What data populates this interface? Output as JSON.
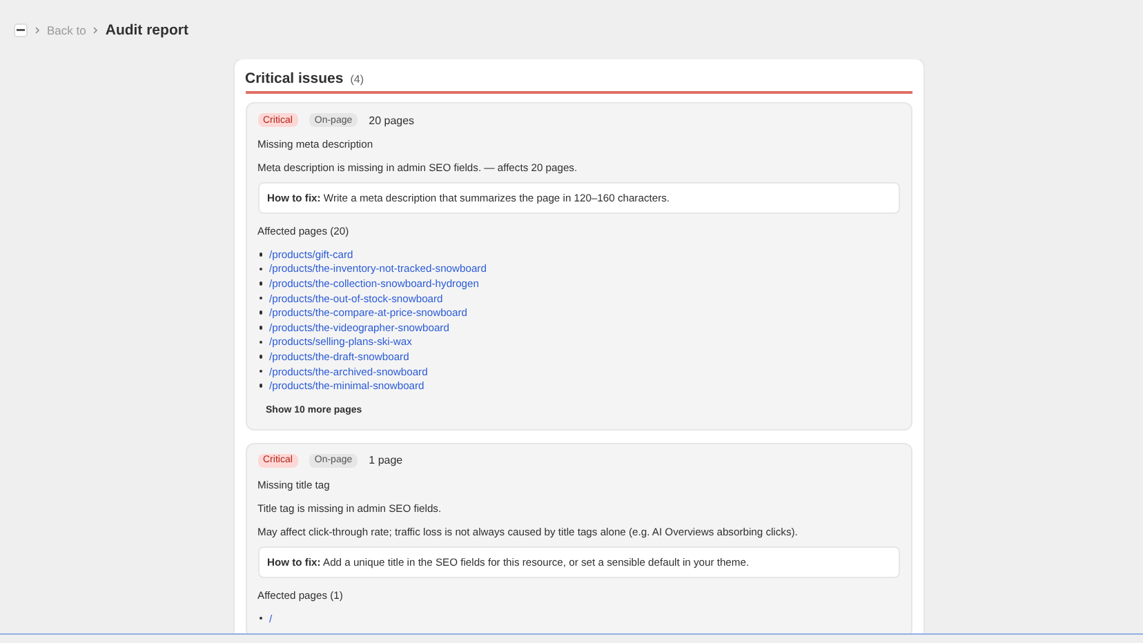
{
  "breadcrumb": {
    "back": "Back to",
    "current": "Audit report"
  },
  "section": {
    "title": "Critical issues",
    "count": "(4)"
  },
  "issues": [
    {
      "severity": "Critical",
      "category": "On-page",
      "page_count": "20 pages",
      "title": "Missing meta description",
      "description": "Meta description is missing in admin SEO fields. — affects 20 pages.",
      "fix": "**How to fix:** Write a meta description that summarizes the page in 120–160 characters.",
      "affected_label": "Affected pages (20)",
      "pages": [
        "/products/gift-card",
        "/products/the-inventory-not-tracked-snowboard",
        "/products/the-collection-snowboard-hydrogen",
        "/products/the-out-of-stock-snowboard",
        "/products/the-compare-at-price-snowboard",
        "/products/the-videographer-snowboard",
        "/products/selling-plans-ski-wax",
        "/products/the-draft-snowboard",
        "/products/the-archived-snowboard",
        "/products/the-minimal-snowboard"
      ],
      "show_more": "Show 10 more pages"
    },
    {
      "severity": "Critical",
      "category": "On-page",
      "page_count": "1 page",
      "title": "Missing title tag",
      "description": "Title tag is missing in admin SEO fields.",
      "note": "May affect click-through rate; traffic loss is not always caused by title tags alone (e.g. AI Overviews absorbing clicks).",
      "fix": "**How to fix:** Add a unique title in the SEO fields for this resource, or set a sensible default in your theme.",
      "affected_label": "Affected pages (1)",
      "pages": [
        "/"
      ]
    }
  ]
}
